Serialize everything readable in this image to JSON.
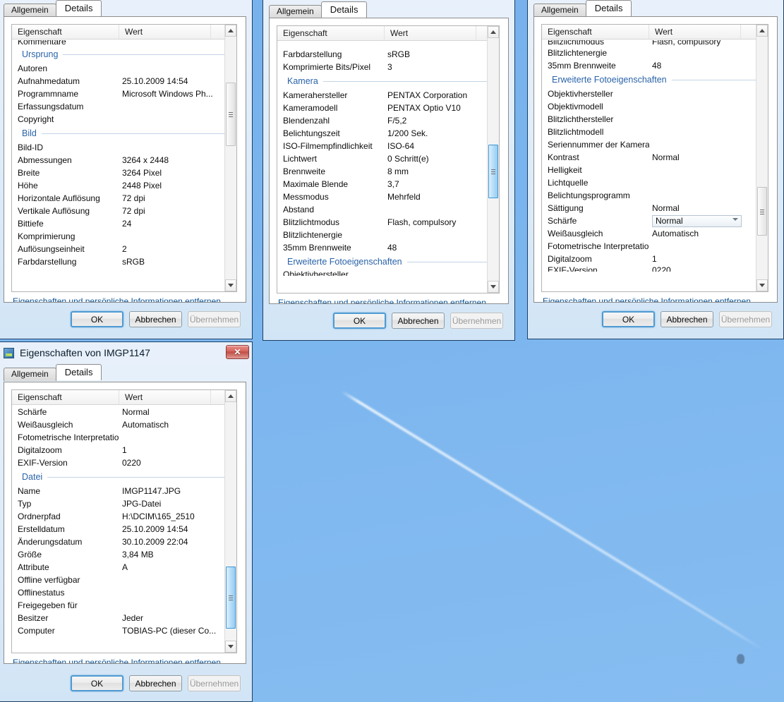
{
  "desktop": {
    "background_name": "sky-with-contrail-photo",
    "sky_color": "#7bb5ee",
    "contrail_color": "#ffffff"
  },
  "common": {
    "tabs": {
      "general": "Allgemein",
      "details": "Details"
    },
    "columns": {
      "property": "Eigenschaft",
      "value": "Wert"
    },
    "remove_link": "Eigenschaften und persönliche Informationen entfernen",
    "buttons": {
      "ok": "OK",
      "cancel": "Abbrechen",
      "apply": "Übernehmen"
    },
    "close_glyph": "✕"
  },
  "windows": [
    {
      "id": "win-top-left",
      "title": null,
      "active_tab": "Details",
      "scroll_thumb_top_pct": 19,
      "scroll_thumb_height_pct": 26,
      "scroll_thumb_hot": false,
      "rows": [
        {
          "type": "clip-top",
          "key": "Kommentare",
          "value": ""
        },
        {
          "type": "group",
          "key": "Ursprung",
          "value": ""
        },
        {
          "type": "row",
          "key": "Autoren",
          "value": ""
        },
        {
          "type": "row",
          "key": "Aufnahmedatum",
          "value": "25.10.2009 14:54"
        },
        {
          "type": "row",
          "key": "Programmname",
          "value": "Microsoft Windows Ph..."
        },
        {
          "type": "row",
          "key": "Erfassungsdatum",
          "value": ""
        },
        {
          "type": "row",
          "key": "Copyright",
          "value": ""
        },
        {
          "type": "group",
          "key": "Bild",
          "value": ""
        },
        {
          "type": "row",
          "key": "Bild-ID",
          "value": ""
        },
        {
          "type": "row",
          "key": "Abmessungen",
          "value": "3264 x 2448"
        },
        {
          "type": "row",
          "key": "Breite",
          "value": "3264 Pixel"
        },
        {
          "type": "row",
          "key": "Höhe",
          "value": "2448 Pixel"
        },
        {
          "type": "row",
          "key": "Horizontale Auflösung",
          "value": "72 dpi"
        },
        {
          "type": "row",
          "key": "Vertikale Auflösung",
          "value": "72 dpi"
        },
        {
          "type": "row",
          "key": "Bittiefe",
          "value": "24"
        },
        {
          "type": "row",
          "key": "Komprimierung",
          "value": ""
        },
        {
          "type": "row",
          "key": "Auflösungseinheit",
          "value": "2"
        },
        {
          "type": "row",
          "key": "Farbdarstellung",
          "value": "sRGB"
        }
      ]
    },
    {
      "id": "win-top-middle",
      "title": null,
      "active_tab": "Details",
      "scroll_thumb_top_pct": 44,
      "scroll_thumb_height_pct": 22,
      "scroll_thumb_hot": true,
      "rows": [
        {
          "type": "clip-top",
          "key": "",
          "value": ""
        },
        {
          "type": "row",
          "key": "Farbdarstellung",
          "value": "sRGB"
        },
        {
          "type": "row",
          "key": "Komprimierte Bits/Pixel",
          "value": "3"
        },
        {
          "type": "group",
          "key": "Kamera",
          "value": ""
        },
        {
          "type": "row",
          "key": "Kamerahersteller",
          "value": "PENTAX Corporation"
        },
        {
          "type": "row",
          "key": "Kameramodell",
          "value": "PENTAX Optio V10"
        },
        {
          "type": "row",
          "key": "Blendenzahl",
          "value": "F/5,2"
        },
        {
          "type": "row",
          "key": "Belichtungszeit",
          "value": "1/200 Sek."
        },
        {
          "type": "row",
          "key": "ISO-Filmempfindlichkeit",
          "value": "ISO-64"
        },
        {
          "type": "row",
          "key": "Lichtwert",
          "value": "0 Schritt(e)"
        },
        {
          "type": "row",
          "key": "Brennweite",
          "value": "8 mm"
        },
        {
          "type": "row",
          "key": "Maximale Blende",
          "value": "3,7"
        },
        {
          "type": "row",
          "key": "Messmodus",
          "value": "Mehrfeld"
        },
        {
          "type": "row",
          "key": "Abstand",
          "value": ""
        },
        {
          "type": "row",
          "key": "Blitzlichtmodus",
          "value": "Flash, compulsory"
        },
        {
          "type": "row",
          "key": "Blitzlichtenergie",
          "value": ""
        },
        {
          "type": "row",
          "key": "35mm Brennweite",
          "value": "48"
        },
        {
          "type": "group",
          "key": "Erweiterte Fotoeigenschaften",
          "value": ""
        },
        {
          "type": "clip-bot",
          "key": "Objektivhersteller",
          "value": ""
        }
      ]
    },
    {
      "id": "win-top-right",
      "title": null,
      "active_tab": "Details",
      "scroll_thumb_top_pct": 62,
      "scroll_thumb_height_pct": 20,
      "scroll_thumb_hot": false,
      "rows": [
        {
          "type": "clip-top",
          "key": "Blitzlichtmodus",
          "value": "Flash, compulsory"
        },
        {
          "type": "row",
          "key": "Blitzlichtenergie",
          "value": ""
        },
        {
          "type": "row",
          "key": "35mm Brennweite",
          "value": "48"
        },
        {
          "type": "group",
          "key": "Erweiterte Fotoeigenschaften",
          "value": ""
        },
        {
          "type": "row",
          "key": "Objektivhersteller",
          "value": ""
        },
        {
          "type": "row",
          "key": "Objektivmodell",
          "value": ""
        },
        {
          "type": "row",
          "key": "Blitzlichthersteller",
          "value": ""
        },
        {
          "type": "row",
          "key": "Blitzlichtmodell",
          "value": ""
        },
        {
          "type": "row",
          "key": "Seriennummer der Kamera",
          "value": ""
        },
        {
          "type": "row",
          "key": "Kontrast",
          "value": "Normal"
        },
        {
          "type": "row",
          "key": "Helligkeit",
          "value": ""
        },
        {
          "type": "row",
          "key": "Lichtquelle",
          "value": ""
        },
        {
          "type": "row",
          "key": "Belichtungsprogramm",
          "value": ""
        },
        {
          "type": "row",
          "key": "Sättigung",
          "value": "Normal"
        },
        {
          "type": "combo",
          "key": "Schärfe",
          "value": "Normal"
        },
        {
          "type": "row",
          "key": "Weißausgleich",
          "value": "Automatisch"
        },
        {
          "type": "row",
          "key": "Fotometrische Interpretation",
          "value": ""
        },
        {
          "type": "row",
          "key": "Digitalzoom",
          "value": "1"
        },
        {
          "type": "clip-bot",
          "key": "EXIF-Version",
          "value": "0220"
        }
      ]
    },
    {
      "id": "win-bottom-left",
      "title": "Eigenschaften von IMGP1147",
      "active_tab": "Details",
      "scroll_thumb_top_pct": 69,
      "scroll_thumb_height_pct": 26,
      "scroll_thumb_hot": true,
      "rows": [
        {
          "type": "row",
          "key": "Schärfe",
          "value": "Normal"
        },
        {
          "type": "row",
          "key": "Weißausgleich",
          "value": "Automatisch"
        },
        {
          "type": "row",
          "key": "Fotometrische Interpretation",
          "value": ""
        },
        {
          "type": "row",
          "key": "Digitalzoom",
          "value": "1"
        },
        {
          "type": "row",
          "key": "EXIF-Version",
          "value": "0220"
        },
        {
          "type": "group",
          "key": "Datei",
          "value": ""
        },
        {
          "type": "row",
          "key": "Name",
          "value": "IMGP1147.JPG"
        },
        {
          "type": "row",
          "key": "Typ",
          "value": "JPG-Datei"
        },
        {
          "type": "row",
          "key": "Ordnerpfad",
          "value": "H:\\DCIM\\165_2510"
        },
        {
          "type": "row",
          "key": "Erstelldatum",
          "value": "25.10.2009 14:54"
        },
        {
          "type": "row",
          "key": "Änderungsdatum",
          "value": "30.10.2009 22:04"
        },
        {
          "type": "row",
          "key": "Größe",
          "value": "3,84 MB"
        },
        {
          "type": "row",
          "key": "Attribute",
          "value": "A"
        },
        {
          "type": "row",
          "key": "Offline verfügbar",
          "value": ""
        },
        {
          "type": "row",
          "key": "Offlinestatus",
          "value": ""
        },
        {
          "type": "row",
          "key": "Freigegeben für",
          "value": ""
        },
        {
          "type": "row",
          "key": "Besitzer",
          "value": "Jeder"
        },
        {
          "type": "row",
          "key": "Computer",
          "value": "TOBIAS-PC (dieser Co..."
        }
      ]
    }
  ]
}
